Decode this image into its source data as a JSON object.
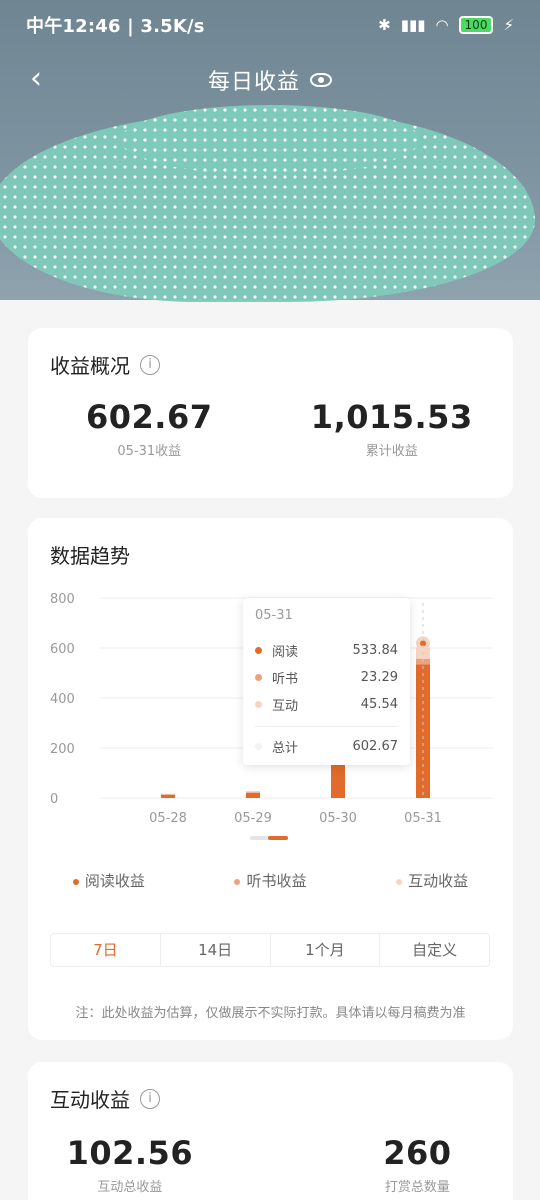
{
  "status_bar": {
    "time": "中午12:46 | 3.5K/s",
    "battery": "100"
  },
  "nav": {
    "title": "每日收益"
  },
  "overview": {
    "title": "收益概况",
    "today_value": "602.67",
    "today_label": "05-31收益",
    "total_value": "1,015.53",
    "total_label": "累计收益"
  },
  "trend": {
    "title": "数据趋势",
    "legend": [
      "阅读收益",
      "听书收益",
      "互动收益"
    ],
    "tabs": [
      "7日",
      "14日",
      "1个月",
      "自定义"
    ],
    "active_tab": "7日",
    "note": "注：此处收益为估算，仅做展示不实际打款。具体请以每月稿费为准",
    "tooltip": {
      "date": "05-31",
      "rows": [
        {
          "label": "阅读",
          "value": "533.84",
          "color": "#e06b2a"
        },
        {
          "label": "听书",
          "value": "23.29",
          "color": "#efa07f"
        },
        {
          "label": "互动",
          "value": "45.54",
          "color": "#f7d3c0"
        }
      ],
      "total_label": "总计",
      "total_value": "602.67"
    }
  },
  "chart_data": {
    "type": "bar",
    "stacked": true,
    "categories": [
      "05-28",
      "05-29",
      "05-30",
      "05-31"
    ],
    "series": [
      {
        "name": "阅读收益",
        "values": [
          12,
          20,
          150,
          533.84
        ],
        "color": "#e06b2a"
      },
      {
        "name": "听书收益",
        "values": [
          2,
          3,
          10,
          23.29
        ],
        "color": "#efa07f"
      },
      {
        "name": "互动收益",
        "values": [
          3,
          5,
          20,
          45.54
        ],
        "color": "#f7d3c0"
      }
    ],
    "yticks": [
      "800",
      "600",
      "400",
      "200",
      "0"
    ],
    "ylim": [
      0,
      800
    ],
    "grid": true,
    "legend_position": "bottom"
  },
  "interaction": {
    "title": "互动收益",
    "total_value": "102.56",
    "total_label": "互动总收益",
    "count_value": "260",
    "count_label": "打赏总数量"
  }
}
